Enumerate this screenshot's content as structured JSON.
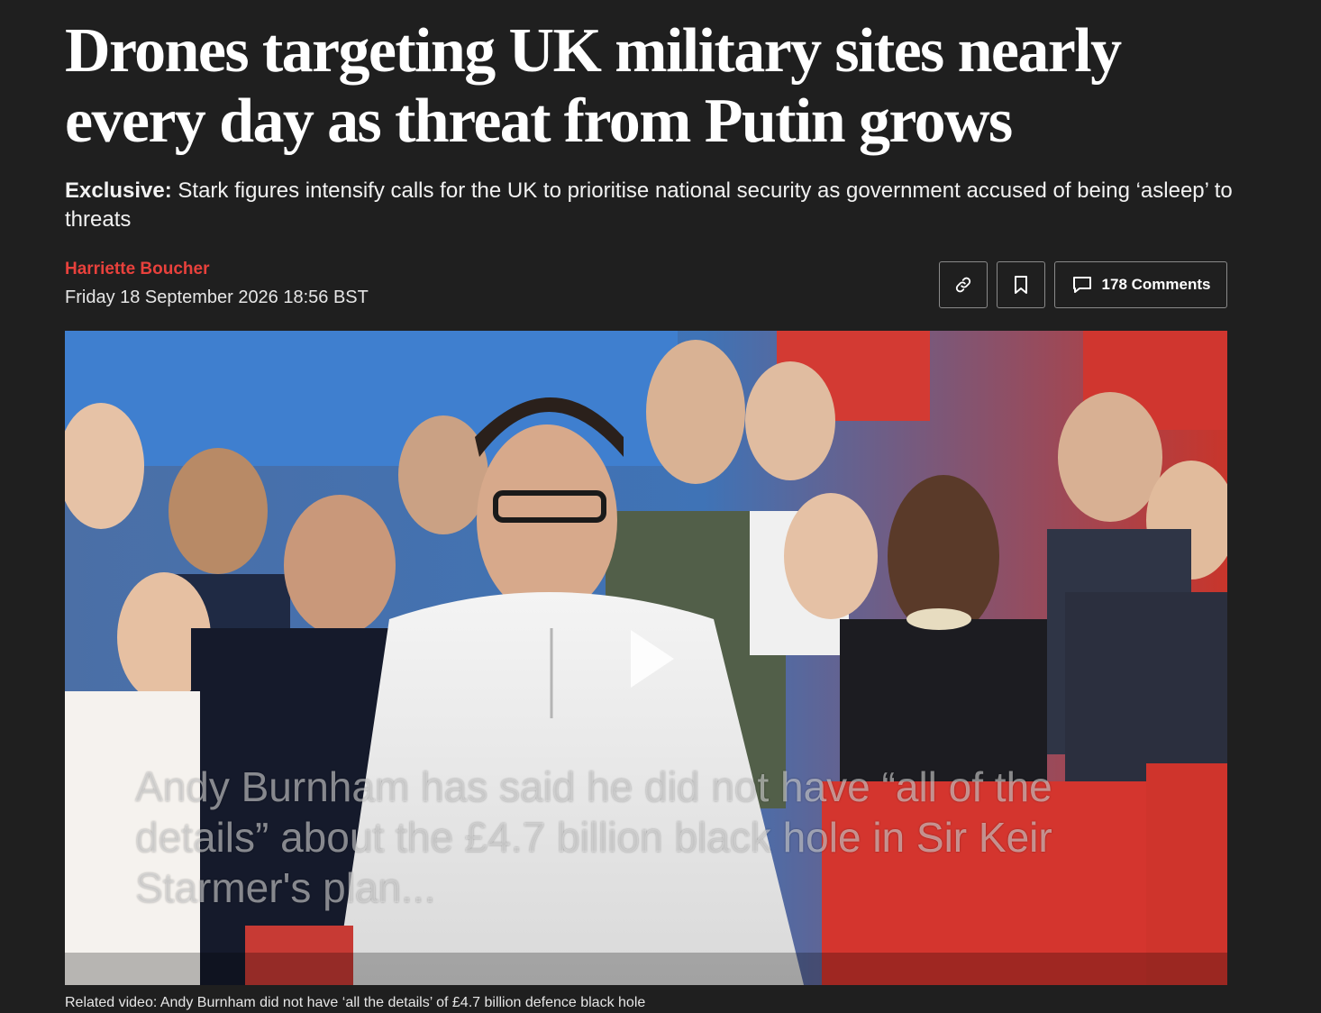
{
  "article": {
    "headline": "Drones targeting UK military sites nearly every day as threat from Putin grows",
    "standfirst_kicker": "Exclusive:",
    "standfirst_text": " Stark figures intensify calls for the UK to prioritise national security as government accused of being ‘asleep’ to threats",
    "author": "Harriette Boucher",
    "dateline": "Friday 18 September 2026 18:56 BST"
  },
  "actions": {
    "share_icon": "link-icon",
    "bookmark_icon": "bookmark-icon",
    "comments_icon": "comment-icon",
    "comments_label": "178 Comments"
  },
  "video": {
    "overlay_text": "Andy Burnham has said he did not have “all of the details” about the £4.7 billion black hole in Sir Keir Starmer's plan...",
    "play_icon": "play-icon",
    "caption": "Related video: Andy Burnham did not have ‘all the details’ of £4.7 billion defence black hole"
  },
  "colors": {
    "background": "#1f1f1f",
    "author": "#e8413c",
    "text": "#f2f2f2"
  }
}
